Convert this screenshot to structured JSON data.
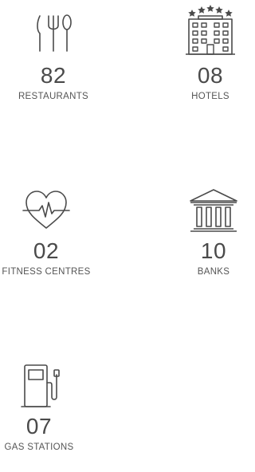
{
  "colors": {
    "icon_stroke": "#4a4a4a",
    "text": "#4a4a4a",
    "label": "#555555",
    "background": "#ffffff"
  },
  "stats": [
    {
      "id": "restaurants",
      "value": "82",
      "label": "RESTAURANTS",
      "icon": "fork-knife-spoon-icon"
    },
    {
      "id": "hotels",
      "value": "08",
      "label": "HOTELS",
      "icon": "hotel-building-icon"
    },
    {
      "id": "fitness",
      "value": "02",
      "label": "FITNESS CENTRES",
      "icon": "heartbeat-icon"
    },
    {
      "id": "banks",
      "value": "10",
      "label": "BANKS",
      "icon": "bank-building-icon"
    },
    {
      "id": "gas",
      "value": "07",
      "label": "GAS STATIONS",
      "icon": "fuel-pump-icon"
    }
  ]
}
